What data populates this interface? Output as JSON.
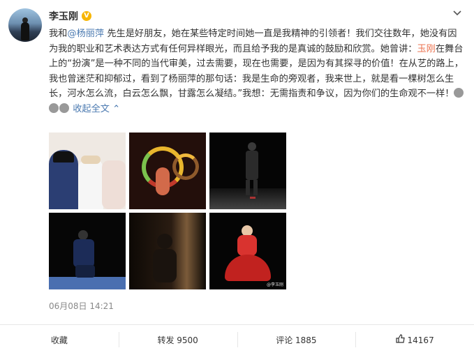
{
  "post": {
    "author": "李玉刚",
    "verified_badge": "V",
    "text_parts": [
      {
        "t": "我和",
        "type": "plain"
      },
      {
        "t": "@杨丽萍",
        "type": "mention"
      },
      {
        "t": " 先生是好朋友，她在某些特定时间她一直是我精神的引领者！我们交往数年，她没有因为我的职业和艺术表达方式有任何异样眼光，而且给予我的是真诚的鼓励和欣赏。她曾讲：",
        "type": "plain"
      },
      {
        "t": "玉刚",
        "type": "highlight"
      },
      {
        "t": "在舞台上的“扮演”是一种不同的当代审美，过去需要，现在也需要，是因为有其探寻的价值！在从艺的路上，我也曾迷茫和抑郁过，看到了杨丽萍的那句话：我是生命的旁观者，我来世上，就是看一棵树怎么生长，河水怎么流，白云怎么飘，甘露怎么凝结。”我想：无需指责和争议，因为你们的生命观不一样！",
        "type": "plain"
      }
    ],
    "collapse_label": "收起全文",
    "collapse_chevron": "^",
    "timestamp": "06月08日 14:21",
    "image_watermark": "@李玉刚"
  },
  "actions": {
    "favorite": "收藏",
    "repost": "转发 9500",
    "comment": "评论 1885",
    "like": "14167"
  },
  "icons": {
    "more": "chevron-down-icon",
    "like": "thumbs-up-icon",
    "emoji": "bow-emoji-icon"
  },
  "colors": {
    "mention": "#4a79b0",
    "highlight": "#eb7350",
    "badge": "#f7b500"
  }
}
